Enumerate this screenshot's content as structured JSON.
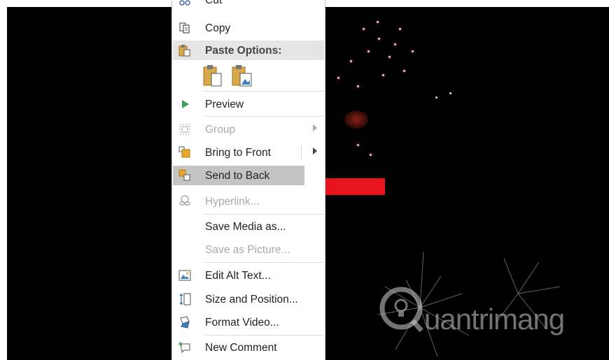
{
  "menu": {
    "cut": {
      "label": "Cut"
    },
    "copy": {
      "label": "Copy"
    },
    "paste_options": {
      "label": "Paste Options:"
    },
    "preview": {
      "label": "Preview"
    },
    "group": {
      "label": "Group"
    },
    "bring_to_front": {
      "label": "Bring to Front"
    },
    "send_to_back": {
      "label": "Send to Back"
    },
    "hyperlink": {
      "label": "Hyperlink..."
    },
    "save_media": {
      "label": "Save Media as..."
    },
    "save_picture": {
      "label": "Save as Picture..."
    },
    "edit_alt_text": {
      "label": "Edit Alt Text..."
    },
    "size_position": {
      "label": "Size and Position..."
    },
    "format_video": {
      "label": "Format Video..."
    },
    "new_comment": {
      "label": "New Comment"
    }
  },
  "watermark": {
    "text": "uantrimang"
  },
  "colors": {
    "arrow": "#e8141c",
    "highlight": "#c4c4c4",
    "video_bg": "#000000"
  }
}
